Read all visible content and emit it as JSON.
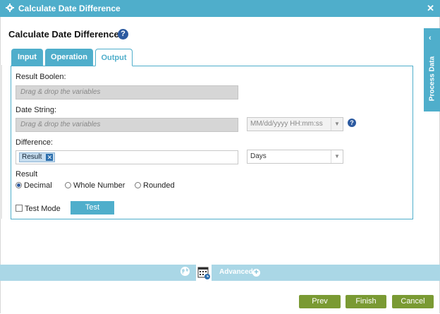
{
  "window": {
    "title": "Calculate Date Difference",
    "close_icon": "✕"
  },
  "page": {
    "heading": "Calculate Date Difference",
    "help_icon": "?"
  },
  "side_panel": {
    "label": "Process Data",
    "arrow": "‹"
  },
  "tabs": [
    {
      "label": "Input",
      "active": false
    },
    {
      "label": "Operation",
      "active": false
    },
    {
      "label": "Output",
      "active": true
    }
  ],
  "form": {
    "result_boolean_label": "Result Boolen:",
    "result_boolean_placeholder": "Drag & drop the variables",
    "date_string_label": "Date String:",
    "date_string_placeholder": "Drag & drop the variables",
    "date_format_value": "MM/dd/yyyy HH:mm:ss",
    "difference_label": "Difference:",
    "difference_chip": "Result",
    "difference_chip_remove": "✕",
    "unit_value": "Days",
    "result_label": "Result",
    "result_options": [
      {
        "label": "Decimal",
        "selected": true
      },
      {
        "label": "Whole Number",
        "selected": false
      },
      {
        "label": "Rounded",
        "selected": false
      }
    ],
    "test_mode_label": "Test Mode",
    "test_mode_checked": false,
    "test_button": "Test"
  },
  "advanced": {
    "label": "Advanced",
    "plus": "+"
  },
  "footer": {
    "prev": "Prev",
    "finish": "Finish",
    "cancel": "Cancel"
  },
  "colors": {
    "accent": "#4faecb",
    "footer_button": "#7a9a33",
    "help": "#2c5aa0"
  }
}
